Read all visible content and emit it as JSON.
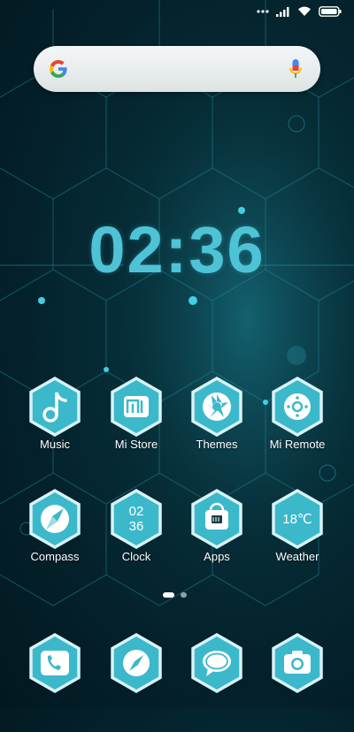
{
  "status_bar": {
    "icons": [
      "dots-icon",
      "signal-icon",
      "wifi-icon",
      "battery-icon"
    ]
  },
  "search": {
    "icons": [
      "google-logo",
      "mic-icon"
    ]
  },
  "clock": {
    "time": "02:36"
  },
  "apps": [
    {
      "label": "Music",
      "icon": "music-note-icon"
    },
    {
      "label": "Mi Store",
      "icon": "mi-store-icon"
    },
    {
      "label": "Themes",
      "icon": "aperture-icon"
    },
    {
      "label": "Mi Remote",
      "icon": "remote-icon"
    },
    {
      "label": "Compass",
      "icon": "compass-icon"
    },
    {
      "label": "Clock",
      "icon": "clock-icon",
      "glyph_hour": "02",
      "glyph_min": "36"
    },
    {
      "label": "Apps",
      "icon": "apps-bag-icon"
    },
    {
      "label": "Weather",
      "icon": "weather-icon",
      "glyph": "18℃"
    }
  ],
  "dock": [
    {
      "icon": "phone-icon"
    },
    {
      "icon": "browser-compass-icon"
    },
    {
      "icon": "messages-icon"
    },
    {
      "icon": "camera-icon"
    }
  ],
  "pages": {
    "count": 2,
    "active": 1
  },
  "colors": {
    "accent": "#4fc3d6",
    "hex_fill": "#3cb8cb",
    "hex_border": "#d8f3f7"
  }
}
